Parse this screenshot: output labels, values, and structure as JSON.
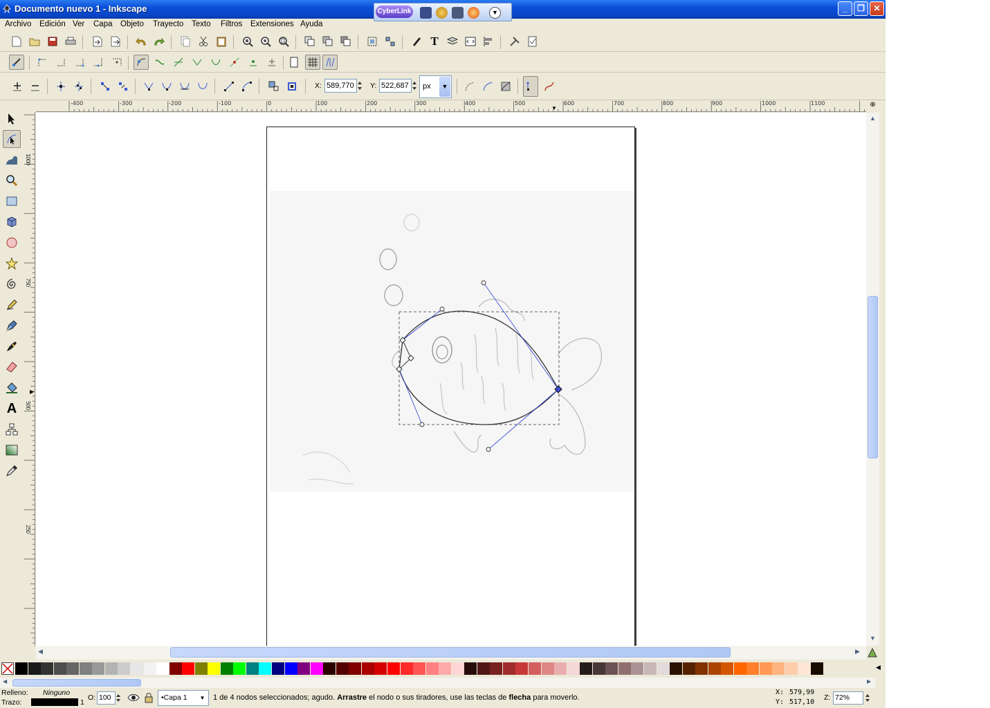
{
  "window": {
    "title": "Documento nuevo 1 - Inkscape",
    "controls": [
      "minimize",
      "restore",
      "close"
    ]
  },
  "cyberlink": {
    "logo": "CyberLink"
  },
  "menubar": {
    "items": [
      "Archivo",
      "Edición",
      "Ver",
      "Capa",
      "Objeto",
      "Trayecto",
      "Texto",
      "Filtros",
      "Extensiones",
      "Ayuda"
    ]
  },
  "node_toolbar": {
    "x_label": "X:",
    "x_value": "589,770",
    "y_label": "Y:",
    "y_value": "522,687",
    "unit": "px"
  },
  "rulers": {
    "horizontal": [
      "-400",
      "-300",
      "-200",
      "-100",
      "0",
      "100",
      "200",
      "300",
      "400",
      "500",
      "600",
      "700",
      "800",
      "900",
      "1000",
      "1100"
    ],
    "vertical": [
      "1000",
      "750",
      "500",
      "250"
    ]
  },
  "palette": {
    "colors": [
      "#000000",
      "#1a1a1a",
      "#333333",
      "#4d4d4d",
      "#666666",
      "#808080",
      "#999999",
      "#b3b3b3",
      "#cccccc",
      "#e6e6e6",
      "#f2f2f2",
      "#ffffff",
      "#800000",
      "#ff0000",
      "#808000",
      "#ffff00",
      "#008000",
      "#00ff00",
      "#008080",
      "#00ffff",
      "#000080",
      "#0000ff",
      "#800080",
      "#ff00ff",
      "#2b0000",
      "#550000",
      "#800000",
      "#aa0000",
      "#d40000",
      "#ff0000",
      "#ff2a2a",
      "#ff5555",
      "#ff8080",
      "#ffaaaa",
      "#ffd5d5",
      "#280b0b",
      "#501616",
      "#782121",
      "#a02c2c",
      "#c83737",
      "#d35f5f",
      "#de8787",
      "#e9afaf",
      "#f4d7d7",
      "#241c1c",
      "#483737",
      "#6c5353",
      "#916f6f",
      "#ac9393",
      "#c8b7b7",
      "#e3dbdb",
      "#2b1100",
      "#552200",
      "#803300",
      "#aa4400",
      "#d45500",
      "#ff6600",
      "#ff7f2a",
      "#ff9955",
      "#ffb380",
      "#ffccaa",
      "#ffe6d5",
      "#1a0d00"
    ]
  },
  "status": {
    "fill_label": "Relleno:",
    "fill_value": "Ninguno",
    "stroke_label": "Trazo:",
    "stroke_width": "1",
    "opacity_label": "O:",
    "opacity_value": "100",
    "layer": "•Capa 1",
    "message_1": "1 de 4 nodos seleccionados; agudo. ",
    "message_bold_1": "Arrastre",
    "message_2": " el nodo o sus tiradores, use las teclas de ",
    "message_bold_2": "flecha",
    "message_3": " para moverlo.",
    "cursor_x_label": "X:",
    "cursor_x": "579,99",
    "cursor_y_label": "Y:",
    "cursor_y": "517,10",
    "zoom_label": "Z:",
    "zoom_value": "72%"
  }
}
